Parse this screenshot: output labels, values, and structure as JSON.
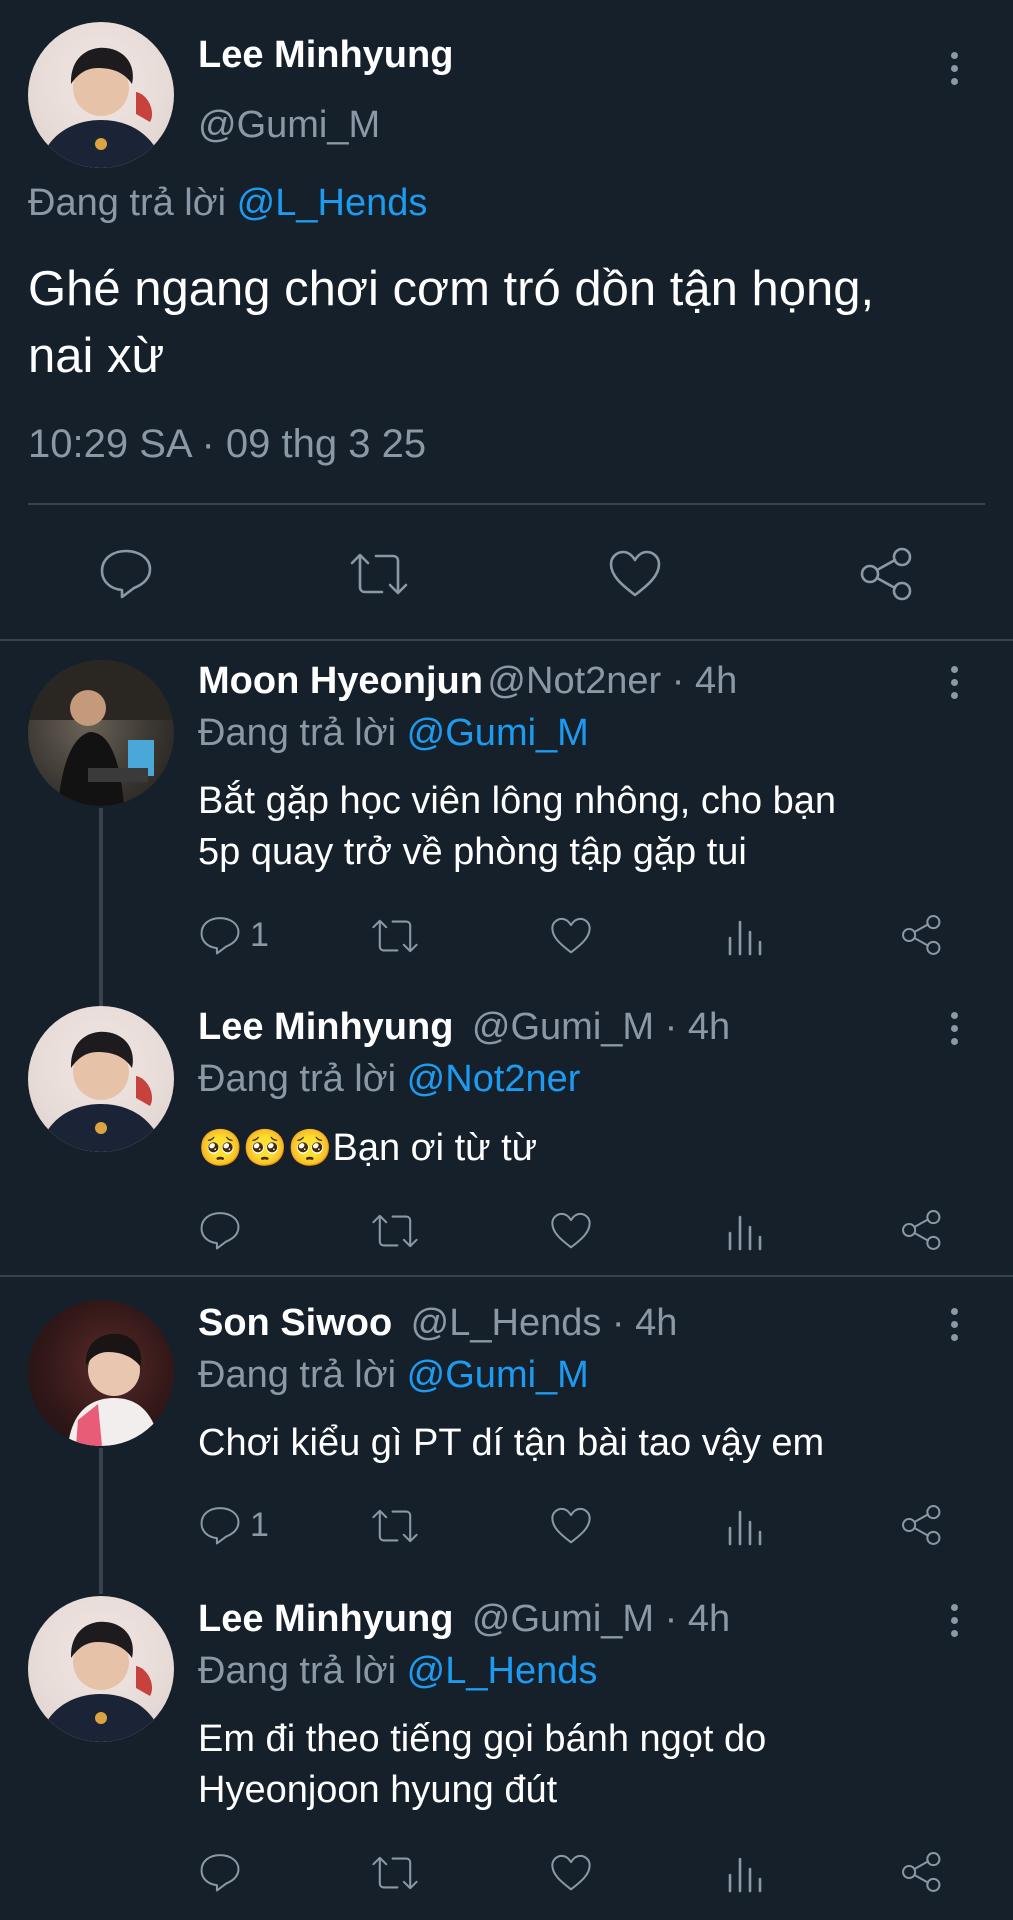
{
  "main_tweet": {
    "name": "Lee Minhyung",
    "handle": "@Gumi_M",
    "reply_prefix": "Đang trả lời",
    "reply_handle": "@L_Hends",
    "text_line1": "Ghé ngang chơi cơm tró dồn tận họng,",
    "text_line2": "nai xừ",
    "timestamp": "10:29 SA · 09 thg 3 25",
    "actions": [
      "reply-icon",
      "retweet-icon",
      "like-icon",
      "share-icon"
    ]
  },
  "replies": [
    {
      "name": "Moon Hyeonjun",
      "handle": "@Not2ner · 4h",
      "reply_prefix": "Đang trả lời",
      "reply_handle": "@Gumi_M",
      "text_line1": "Bắt gặp học viên lông nhông, cho bạn",
      "text_line2": "5p quay trở về phòng tập gặp tui",
      "reply_count": "1"
    },
    {
      "name": "Lee Minhyung",
      "handle": "@Gumi_M · 4h",
      "reply_prefix": "Đang trả lời",
      "reply_handle": "@Not2ner",
      "emojis": "🥺🥺🥺",
      "text_line1": "Bạn ơi từ từ",
      "reply_count": ""
    },
    {
      "name": "Son Siwoo",
      "handle": "@L_Hends · 4h",
      "reply_prefix": "Đang trả lời",
      "reply_handle": "@Gumi_M",
      "text_line1": "Chơi kiểu gì PT dí tận bài tao vậy em",
      "reply_count": "1"
    },
    {
      "name": "Lee Minhyung",
      "handle": "@Gumi_M · 4h",
      "reply_prefix": "Đang trả lời",
      "reply_handle": "@L_Hends",
      "text_line1": "Em đi theo tiếng gọi bánh ngọt do",
      "text_line2": "Hyeonjoon hyung đút",
      "reply_count": ""
    }
  ],
  "colors": {
    "background": "#15202b",
    "text": "#ffffff",
    "muted": "#8b98a5",
    "link": "#1d9bf0",
    "divider": "#38444d"
  }
}
